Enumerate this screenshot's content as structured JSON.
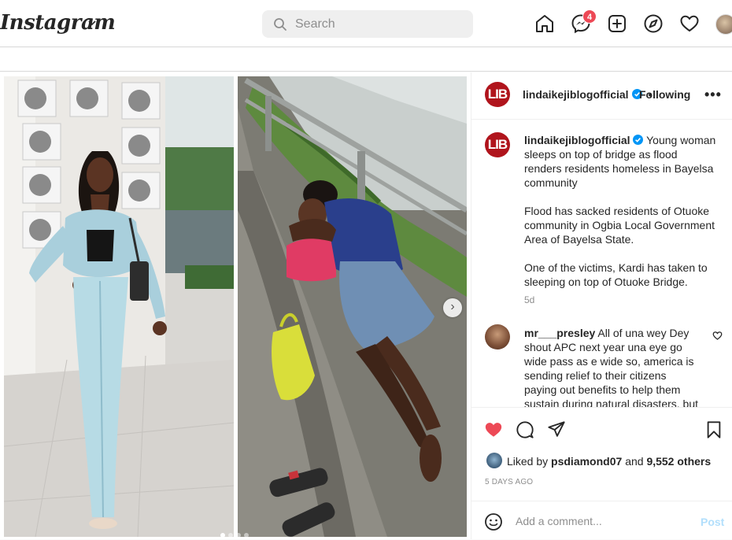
{
  "header": {
    "logo": "Instagram",
    "search_placeholder": "Search",
    "messages_badge": "4",
    "icons": [
      "home-icon",
      "messenger-icon",
      "new-post-icon",
      "explore-icon",
      "activity-heart-icon",
      "profile-avatar"
    ]
  },
  "post": {
    "author": "lindaikejiblogofficial",
    "avatar_text": "LIB",
    "verified": true,
    "follow_label": "Following",
    "more_label": "•••",
    "separator": "•",
    "caption_paragraphs": [
      "Young woman sleeps on top of bridge as flood renders residents homeless in Bayelsa community",
      "Flood has sacked residents of Otuoke community in Ogbia Local Government Area of Bayelsa State.",
      "One of the victims, Kardi has taken to sleeping on top of Otuoke Bridge."
    ],
    "caption_time": "5d",
    "comments": [
      {
        "user": "mr___presley",
        "text": "All of una wey Dey shout APC next year una eye go wide pass as e wide so, america is sending relief to their citizens paying out benefits to help them sustain during natural disasters, but"
      }
    ],
    "liked_by_prefix": "Liked by",
    "liked_by_user": "psdiamond07",
    "liked_by_and": "and",
    "liked_by_others": "9,552 others",
    "time_ago": "5 DAYS AGO",
    "comment_placeholder": "Add a comment...",
    "post_button": "Post",
    "carousel": {
      "total": 4,
      "current": 1
    },
    "colors": {
      "like": "#ed4956",
      "verified": "#0095f6",
      "post_button_disabled": "#b2dffc",
      "avatar_brand": "#b0141c"
    }
  }
}
